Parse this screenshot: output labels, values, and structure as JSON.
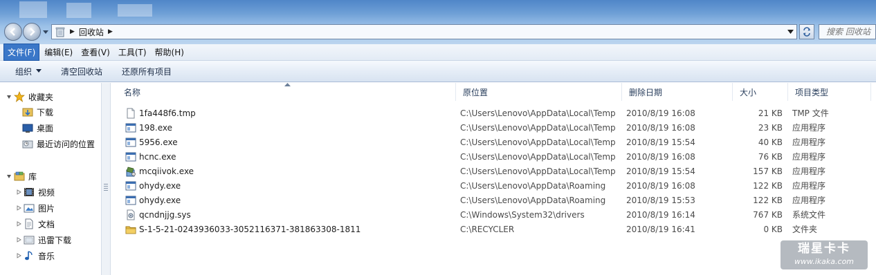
{
  "address": {
    "crumb": "回收站"
  },
  "search": {
    "placeholder": "搜索 回收站"
  },
  "menu": [
    "文件(F)",
    "编辑(E)",
    "查看(V)",
    "工具(T)",
    "帮助(H)"
  ],
  "commands": {
    "organize": "组织",
    "empty": "清空回收站",
    "restore_all": "还原所有项目"
  },
  "nav": {
    "favorites": "收藏夹",
    "downloads": "下载",
    "desktop": "桌面",
    "recent": "最近访问的位置",
    "libraries": "库",
    "videos": "视频",
    "pictures": "图片",
    "documents": "文档",
    "xunlei": "迅雷下载",
    "music": "音乐"
  },
  "columns": {
    "name": "名称",
    "location": "原位置",
    "deleted": "删除日期",
    "size": "大小",
    "type": "项目类型"
  },
  "files": [
    {
      "name": "1fa448f6.tmp",
      "location": "C:\\Users\\Lenovo\\AppData\\Local\\Temp",
      "deleted": "2010/8/19 16:08",
      "size": "21 KB",
      "type": "TMP 文件",
      "icon": "blank-file-icon"
    },
    {
      "name": "198.exe",
      "location": "C:\\Users\\Lenovo\\AppData\\Local\\Temp",
      "deleted": "2010/8/19 16:08",
      "size": "23 KB",
      "type": "应用程序",
      "icon": "exe-icon"
    },
    {
      "name": "5956.exe",
      "location": "C:\\Users\\Lenovo\\AppData\\Local\\Temp",
      "deleted": "2010/8/19 15:54",
      "size": "40 KB",
      "type": "应用程序",
      "icon": "exe-icon"
    },
    {
      "name": "hcnc.exe",
      "location": "C:\\Users\\Lenovo\\AppData\\Local\\Temp",
      "deleted": "2010/8/19 16:08",
      "size": "76 KB",
      "type": "应用程序",
      "icon": "exe-icon"
    },
    {
      "name": "mcqiivok.exe",
      "location": "C:\\Users\\Lenovo\\AppData\\Local\\Temp",
      "deleted": "2010/8/19 15:54",
      "size": "157 KB",
      "type": "应用程序",
      "icon": "setup-exe-icon"
    },
    {
      "name": "ohydy.exe",
      "location": "C:\\Users\\Lenovo\\AppData\\Roaming",
      "deleted": "2010/8/19 16:08",
      "size": "122 KB",
      "type": "应用程序",
      "icon": "exe-icon"
    },
    {
      "name": "ohydy.exe",
      "location": "C:\\Users\\Lenovo\\AppData\\Roaming",
      "deleted": "2010/8/19 15:53",
      "size": "122 KB",
      "type": "应用程序",
      "icon": "exe-icon"
    },
    {
      "name": "qcndnjjg.sys",
      "location": "C:\\Windows\\System32\\drivers",
      "deleted": "2010/8/19 16:14",
      "size": "767 KB",
      "type": "系统文件",
      "icon": "sys-file-icon"
    },
    {
      "name": "S-1-5-21-0243936033-3052116371-381863308-1811",
      "location": "C:\\RECYCLER",
      "deleted": "2010/8/19 16:41",
      "size": "0 KB",
      "type": "文件夹",
      "icon": "folder-icon"
    }
  ],
  "watermark": {
    "line1": "瑞星卡卡",
    "line2": "www.ikaka.com"
  }
}
